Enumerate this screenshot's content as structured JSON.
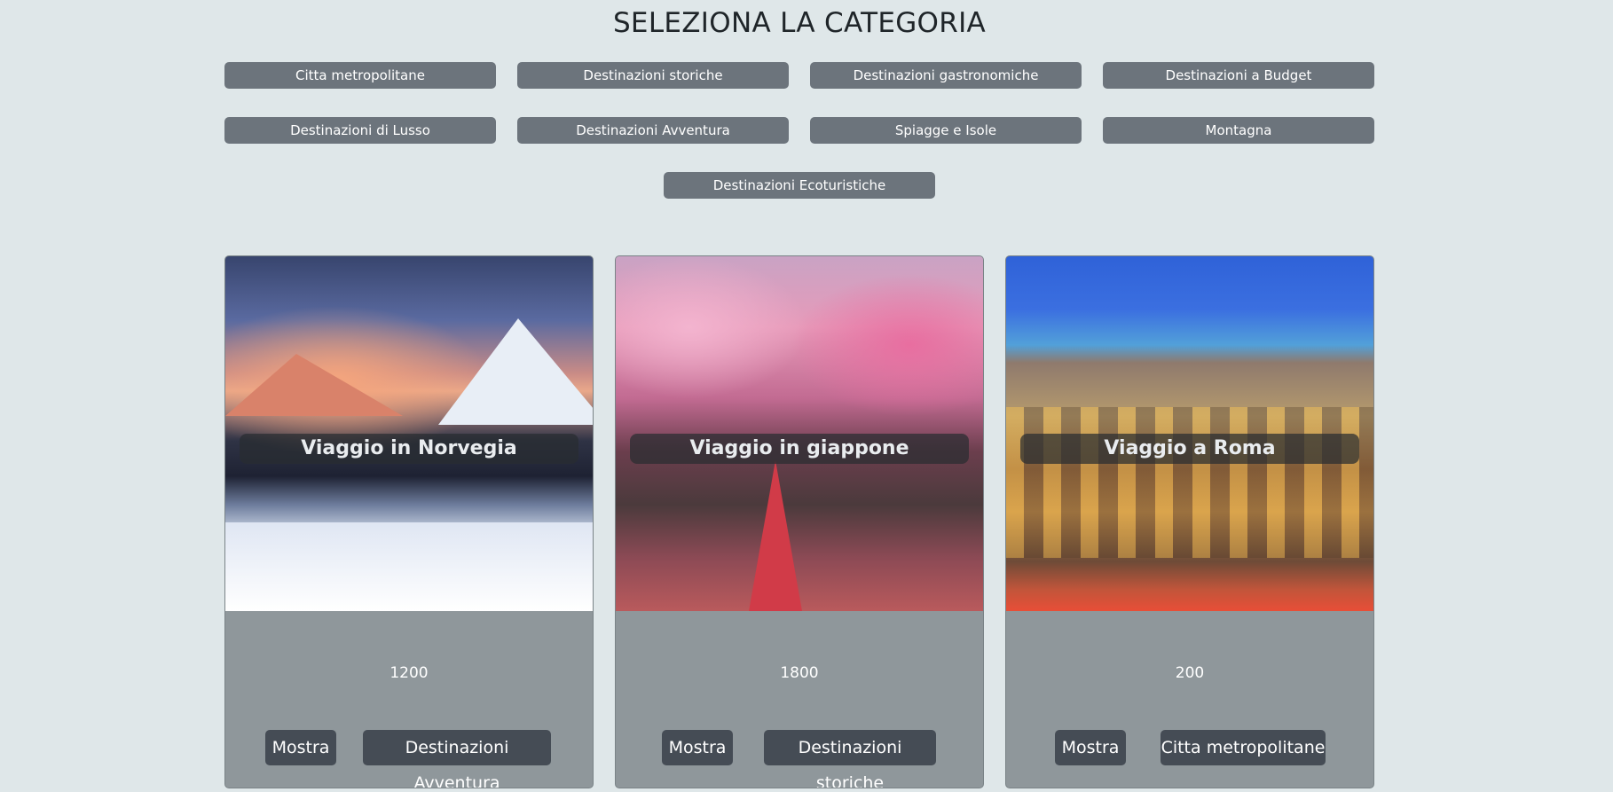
{
  "header": {
    "title": "SELEZIONA LA CATEGORIA"
  },
  "categories": [
    "Citta metropolitane",
    "Destinazioni storiche",
    "Destinazioni gastronomiche",
    "Destinazioni a Budget",
    "Destinazioni di Lusso",
    "Destinazioni Avventura",
    "Spiagge e Isole",
    "Montagna",
    "Destinazioni Ecoturistiche"
  ],
  "cards": [
    {
      "title": "Viaggio in Norvegia",
      "price": "1200",
      "show_label": "Mostra",
      "category_label": "Destinazioni Avventura",
      "image": "norway-snowy-fjord-sunset"
    },
    {
      "title": "Viaggio in giappone",
      "price": "1800",
      "show_label": "Mostra",
      "category_label": "Destinazioni storiche",
      "image": "japan-cherry-blossom-canal"
    },
    {
      "title": "Viaggio a Roma",
      "price": "200",
      "show_label": "Mostra",
      "category_label": "Citta metropolitane",
      "image": "rome-colosseum-night"
    }
  ],
  "colors": {
    "background": "#dfe7e9",
    "category_button": "#6c747c",
    "card_body": "#8f979b",
    "action_button": "#454c55"
  }
}
